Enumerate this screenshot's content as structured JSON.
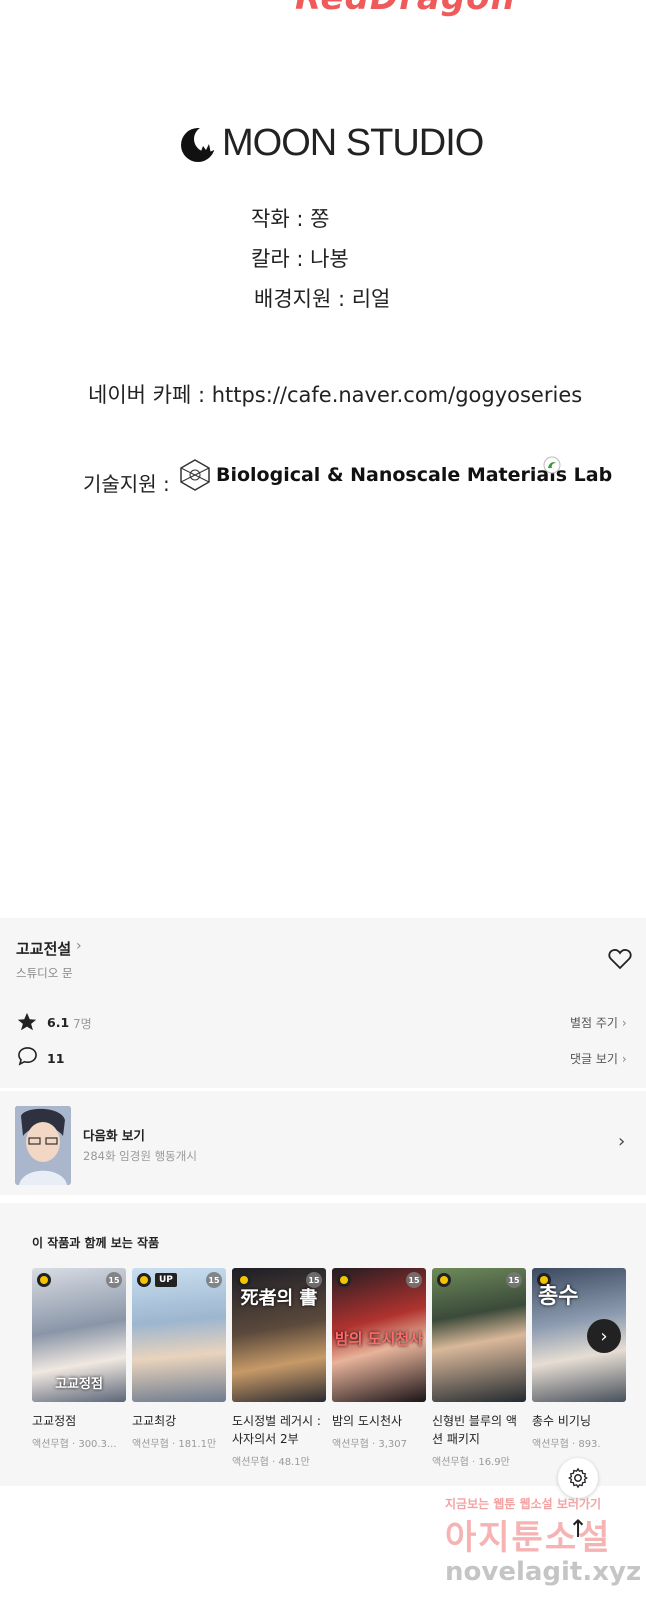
{
  "credits": {
    "top_logo_fragment": "RedDragon",
    "studio_name": "MOON STUDIO",
    "artist": "작화 : 쫑",
    "color": "칼라 : 나봉",
    "background": "배경지원 : 리얼",
    "cafe": "네이버 카페 : https://cafe.naver.com/gogyoseries",
    "tech_label": "기술지원 :",
    "lab_name": "Biological & Nanoscale Materials Lab"
  },
  "info": {
    "title": "고교전설",
    "author": "스튜디오 문",
    "rating": "6.1",
    "raters": "7명",
    "rate_button": "별점 주기",
    "comments": "11",
    "comment_button": "댓글 보기"
  },
  "next_episode": {
    "label": "다음화 보기",
    "subtitle": "284화 임경원 행동개시"
  },
  "recommendations": {
    "heading": "이 작품과 함께 보는 작품",
    "items": [
      {
        "name": "고교정점",
        "meta": "액션무협 · 300.3...",
        "badge_up": false,
        "age": "15",
        "cover_text": "고교정점"
      },
      {
        "name": "고교최강",
        "meta": "액션무협 · 181.1만",
        "badge_up": true,
        "up_label": "UP",
        "age": "15",
        "cover_text": ""
      },
      {
        "name": "도시정벌 레거시 : 사자의서 2부",
        "meta": "액션무협 · 48.1만",
        "badge_up": false,
        "age": "15",
        "cover_text": "死者의 書"
      },
      {
        "name": "밤의 도시천사",
        "meta": "액션무협 · 3,307",
        "badge_up": false,
        "age": "15",
        "cover_text": "밤의 도시천사"
      },
      {
        "name": "신형빈 블루의 액션 패키지",
        "meta": "액션무협 · 16.9만",
        "badge_up": false,
        "age": "15",
        "cover_text": ""
      },
      {
        "name": "총수 비기닝",
        "meta": "액션무협 · 893.",
        "badge_up": false,
        "age": "",
        "cover_text": "총수"
      }
    ]
  },
  "watermark": {
    "line1": "지금보는 웹툰 웹소설 보러가기",
    "line2": "아지툰소설",
    "line3": "novelagit.xyz"
  },
  "icons": {
    "heart": "heart-icon",
    "star": "star-icon",
    "comment": "comment-icon",
    "chevron": "chevron-right-icon",
    "gear": "gear-icon",
    "to_top": "arrow-up-icon",
    "clock": "clock-icon"
  },
  "colors": {
    "panel_bg": "#f6f6f6",
    "clock_badge": "#f5c400",
    "logo_fragment": "#ef5b5b"
  }
}
